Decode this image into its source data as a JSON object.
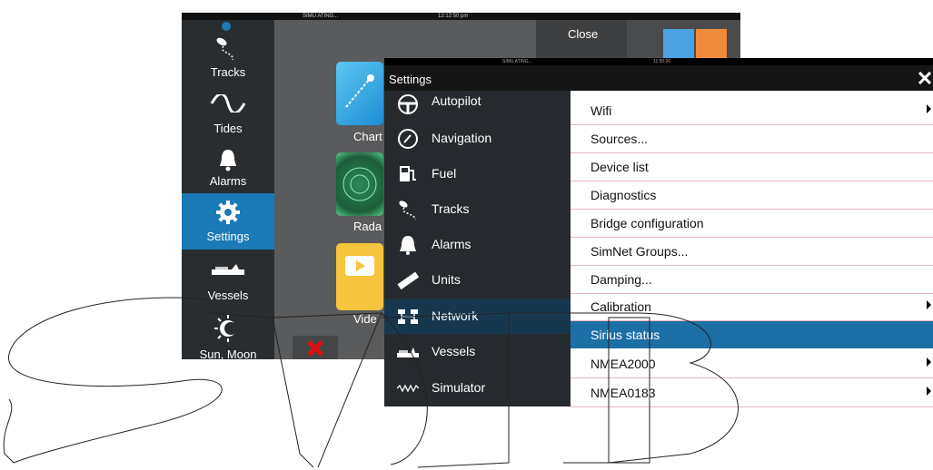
{
  "back_screen": {
    "status_left": "SIMU ATING...",
    "status_time": "12:12:50 pm",
    "close_label": "Close",
    "sidebar": [
      {
        "label": "Tracks",
        "icon": "tracks-icon"
      },
      {
        "label": "Tides",
        "icon": "tides-icon"
      },
      {
        "label": "Alarms",
        "icon": "bell-icon"
      },
      {
        "label": "Settings",
        "icon": "gear-icon"
      },
      {
        "label": "Vessels",
        "icon": "vessels-icon"
      },
      {
        "label": "Sun, Moon",
        "icon": "sun-moon-icon"
      }
    ],
    "apps": [
      {
        "label": "Chart",
        "shown": "Chart"
      },
      {
        "label": "Radar",
        "shown": "Rada"
      },
      {
        "label": "Video",
        "shown": "Vide"
      }
    ]
  },
  "dialog": {
    "status_left": "SIMU ATING...",
    "status_time": "11:50:26",
    "title": "Settings",
    "close_icon": "close-icon",
    "menu": [
      {
        "label": "Autopilot",
        "icon": "steering-wheel-icon"
      },
      {
        "label": "Navigation",
        "icon": "compass-icon"
      },
      {
        "label": "Fuel",
        "icon": "fuel-pump-icon"
      },
      {
        "label": "Tracks",
        "icon": "tracks-icon"
      },
      {
        "label": "Alarms",
        "icon": "bell-icon"
      },
      {
        "label": "Units",
        "icon": "ruler-icon"
      },
      {
        "label": "Network",
        "icon": "network-icon"
      },
      {
        "label": "Vessels",
        "icon": "vessels-icon"
      },
      {
        "label": "Simulator",
        "icon": "simulator-icon"
      }
    ],
    "selected_menu": "Network",
    "options": [
      {
        "label": "Wifi",
        "has_submenu": true
      },
      {
        "label": "Sources...",
        "has_submenu": false
      },
      {
        "label": "Device list",
        "has_submenu": false
      },
      {
        "label": "Diagnostics",
        "has_submenu": false
      },
      {
        "label": "Bridge configuration",
        "has_submenu": false
      },
      {
        "label": "SimNet Groups...",
        "has_submenu": false
      },
      {
        "label": "Damping...",
        "has_submenu": false
      },
      {
        "label": "Calibration",
        "has_submenu": true
      },
      {
        "label": "Sirius status",
        "has_submenu": false
      },
      {
        "label": "NMEA2000",
        "has_submenu": true
      },
      {
        "label": "NMEA0183",
        "has_submenu": true
      }
    ],
    "selected_option": "Sirius status"
  },
  "colors": {
    "accent": "#1d6fa5",
    "selected_menu_bg": "#16384f",
    "sidebar_selected": "#1a7ab5",
    "divider": "#e7b9be"
  }
}
